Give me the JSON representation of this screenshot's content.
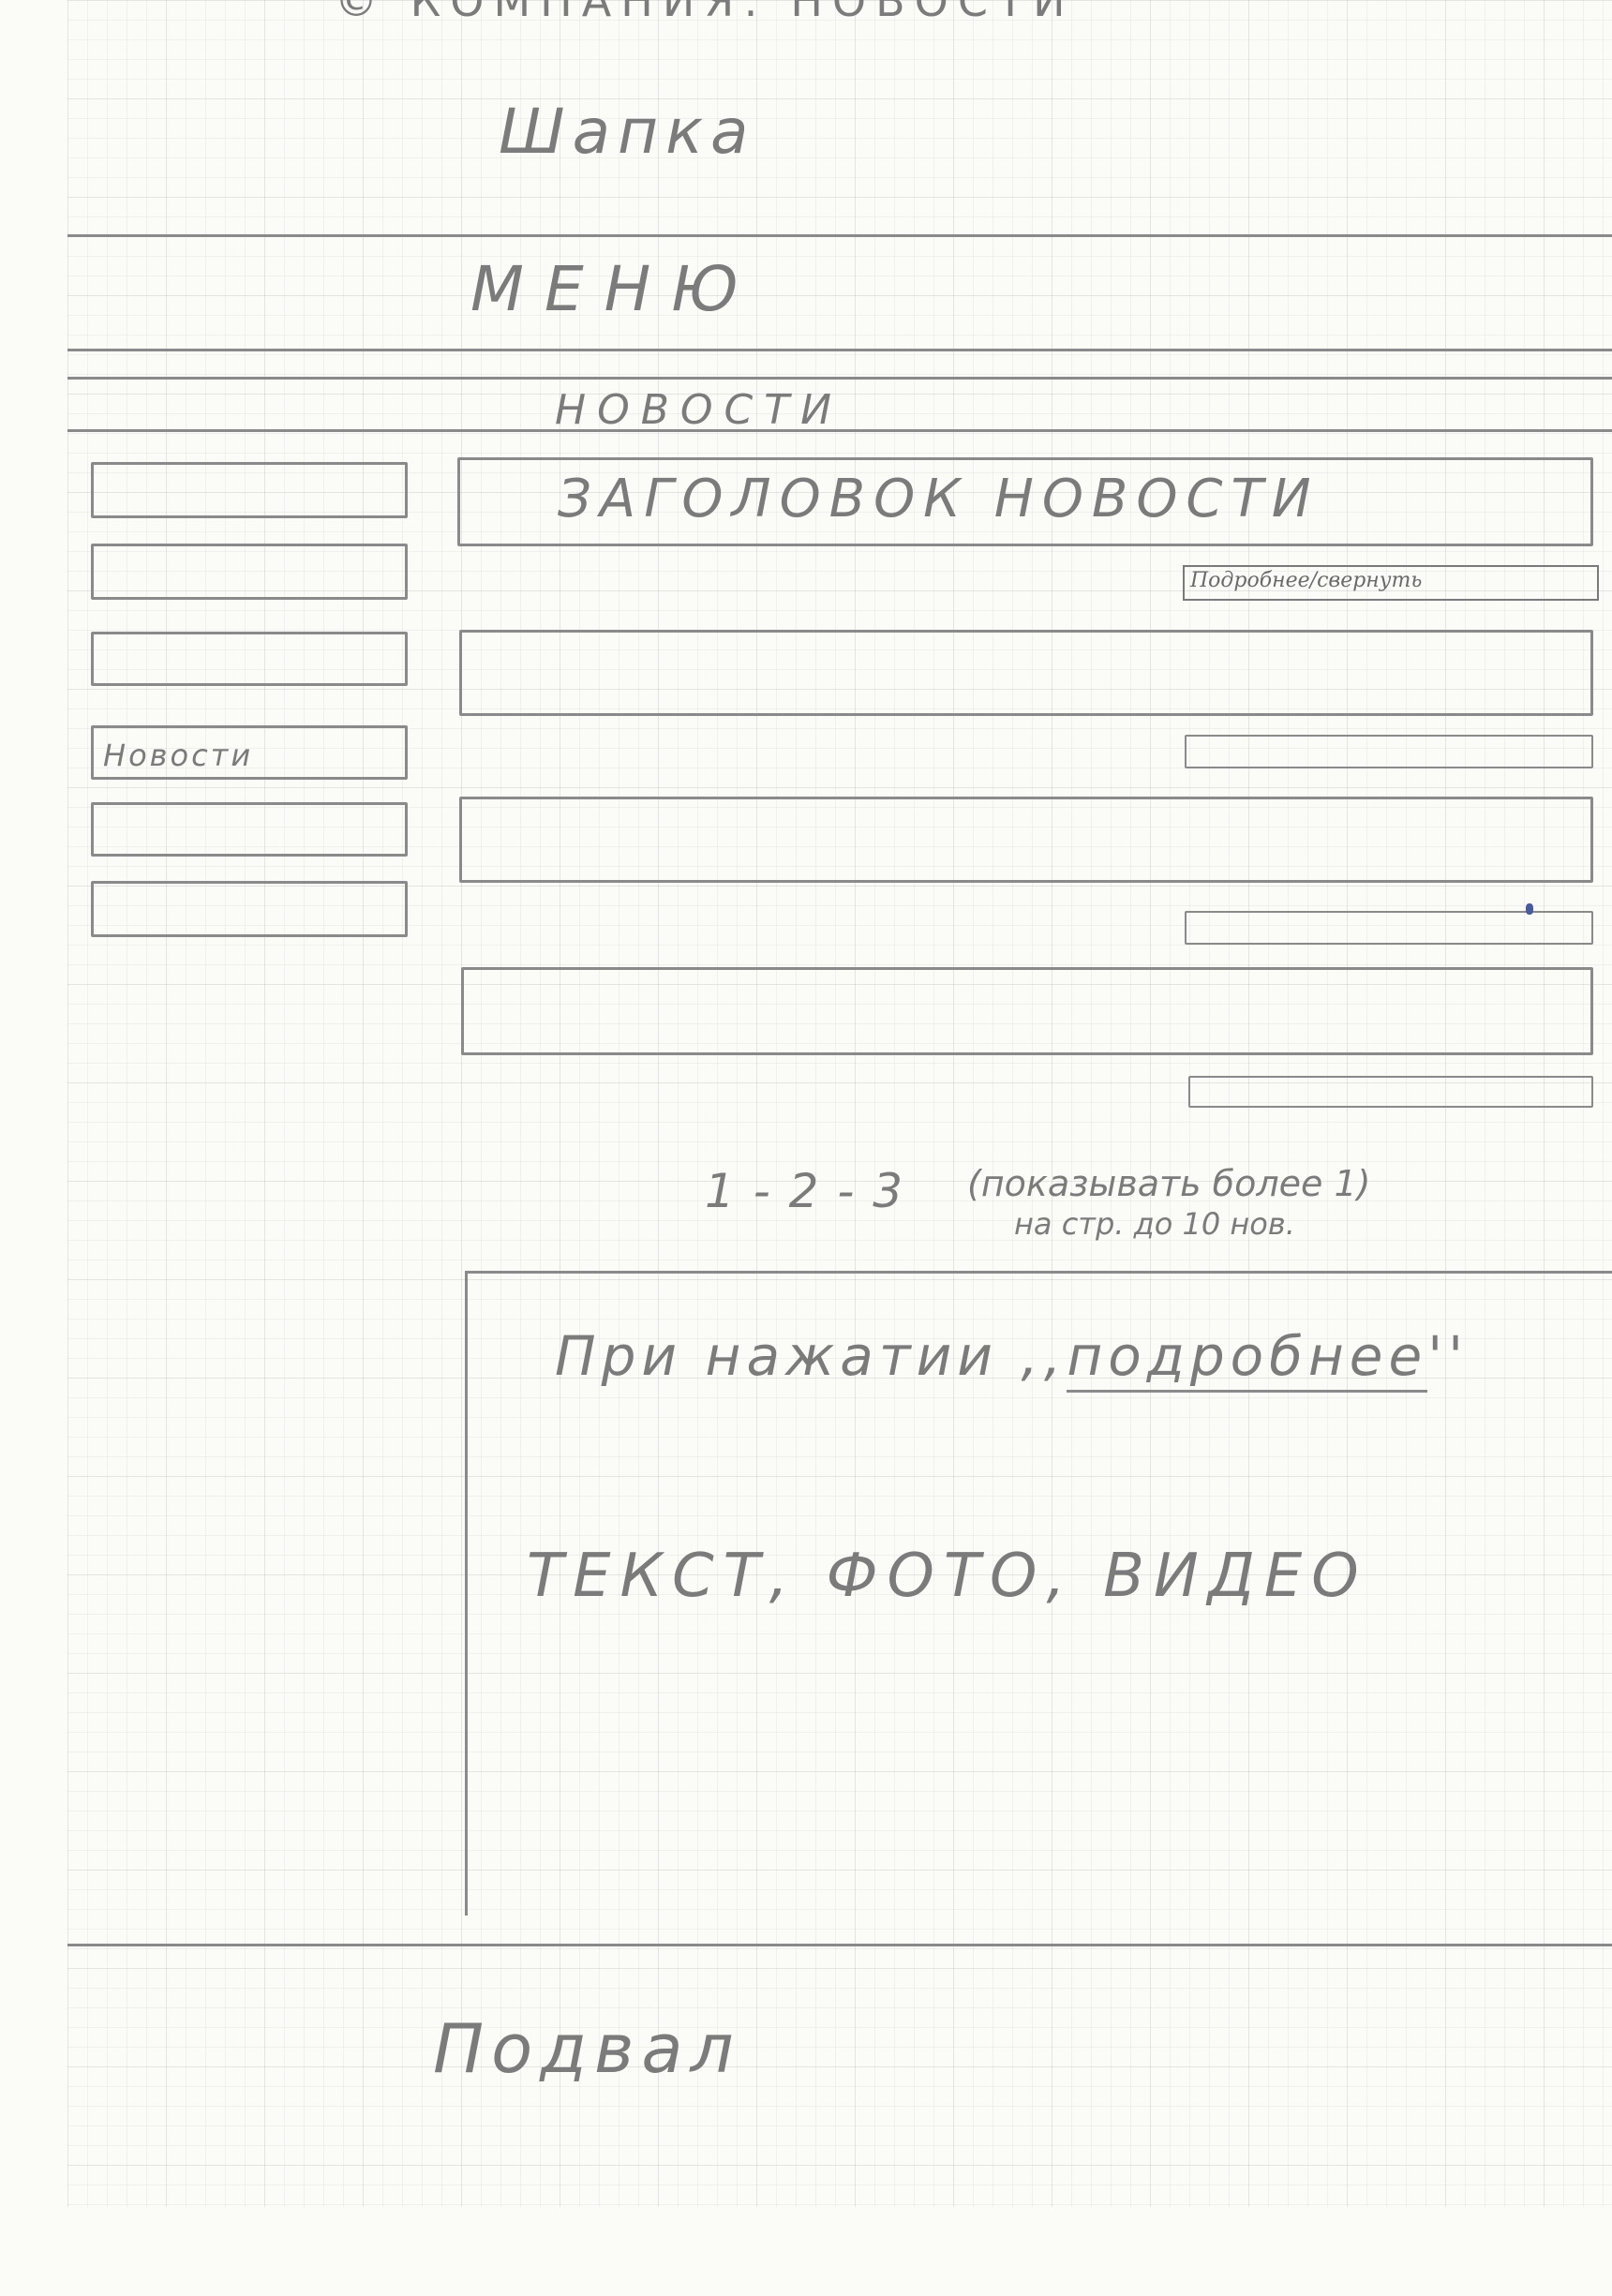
{
  "top_note": "© КОМПАНИЯ: НОВОСТИ",
  "header": {
    "label": "Шапка"
  },
  "menu": {
    "label": "МЕНЮ"
  },
  "section": {
    "title": "НОВОСТИ"
  },
  "sidebar": {
    "items": [
      {
        "label": ""
      },
      {
        "label": ""
      },
      {
        "label": ""
      },
      {
        "label": "Новости"
      },
      {
        "label": ""
      },
      {
        "label": ""
      }
    ]
  },
  "news": {
    "headline": "ЗАГОЛОВОК НОВОСТИ",
    "more_link": "Подробнее/свернуть"
  },
  "pagination": {
    "pages": "1 - 2 - 3",
    "note_line1": "(показывать более 1)",
    "note_line2": "на стр. до 10 нов."
  },
  "detail": {
    "line1_prefix": "При нажатии ,,",
    "line1_link": "подробнее",
    "line1_suffix": "''",
    "line2": "ТЕКСТ, ФОТО, ВИДЕО"
  },
  "footer": {
    "label": "Подвал"
  }
}
